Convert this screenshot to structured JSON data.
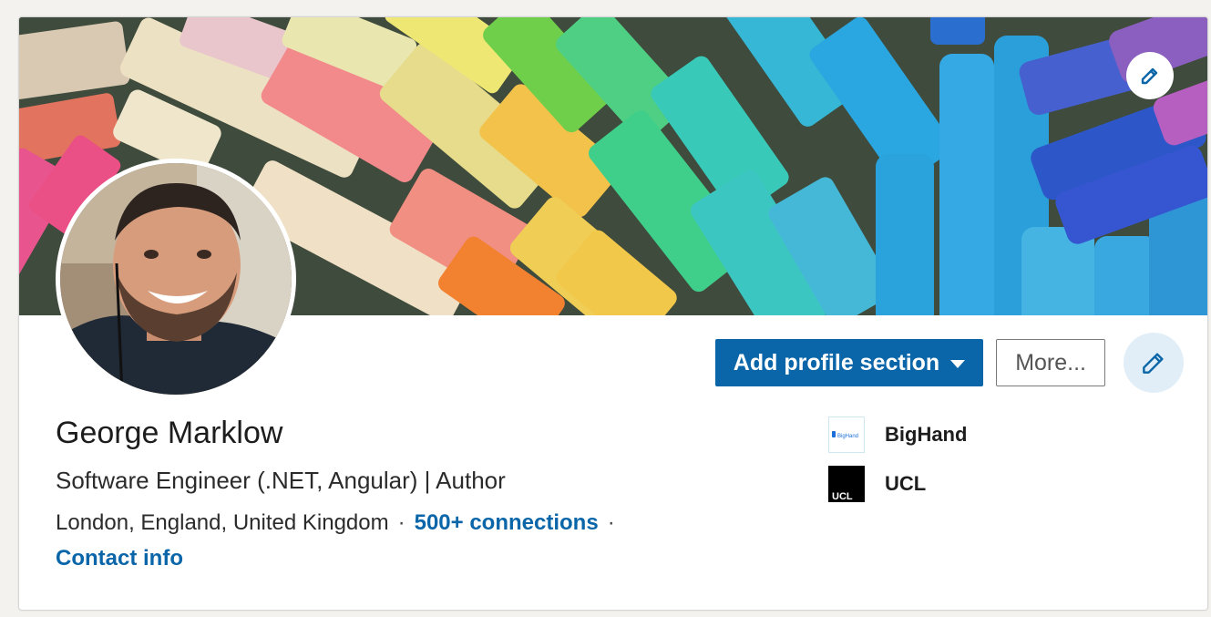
{
  "profile": {
    "name": "George Marklow",
    "headline": "Software Engineer (.NET, Angular) | Author",
    "location": "London, England, United Kingdom",
    "connections": "500+ connections",
    "contact_info": "Contact info",
    "separator": "·"
  },
  "actions": {
    "add_section": "Add profile section",
    "more": "More..."
  },
  "companies": [
    {
      "name": "BigHand",
      "logo_text": "BigHand"
    },
    {
      "name": "UCL",
      "logo_text": "UCL"
    }
  ],
  "icons": {
    "banner_edit": "pencil-icon",
    "intro_edit": "pencil-icon",
    "dropdown": "caret-down-icon"
  },
  "colors": {
    "accent": "#0a66a8",
    "edit_circle_bg": "#e1eef7",
    "page_bg": "#f3f2ef"
  }
}
